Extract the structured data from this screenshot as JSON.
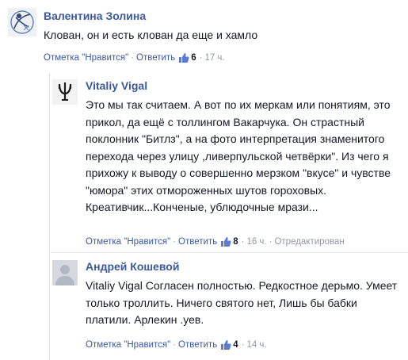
{
  "comments": [
    {
      "author": "Валентина Золина",
      "text": "Клован, он и есть клован да еще и хамло",
      "like_label": "Отметка \"Нравится\"",
      "reply_label": "Ответить",
      "likes": "6",
      "time": "17 ч.",
      "edited": ""
    },
    {
      "author": "Vitaliy Vigal",
      "text": "Это мы так считаем. А вот по их меркам или понятиям, это прикол, да ещё с толлингом Вакарчука. Он страстный поклонник \"Битлз\", а на фото интерпретация знаменитого перехода через улицу ,ливерпульской четвёрки\". Из чего я прихожу к выводу о совершенно мерзком \"вкусе\" и чувстве \"юмора\" этих отмороженных шутов гороховых. Креативчик...Конченые, ублюдочные мрази...",
      "like_label": "Отметка \"Нравится\"",
      "reply_label": "Ответить",
      "likes": "8",
      "time": "16 ч.",
      "edited": "Отредактирован"
    },
    {
      "author": "Андрей Кошевой",
      "text": "Vitaliy Vigal Согласен полностью. Редкостное дерьмо. Умеет только троллить. Ничего святого нет, Лишь бы бабки платили. Арлекин .уев.",
      "like_label": "Отметка \"Нравится\"",
      "reply_label": "Ответить",
      "likes": "4",
      "time": "14 ч.",
      "edited": ""
    }
  ],
  "icons": {
    "thumb": "thumbs-up-icon",
    "avatar_default": "default-avatar-icon"
  },
  "colors": {
    "link": "#3b5998",
    "meta": "#9197a3",
    "text": "#141823"
  }
}
